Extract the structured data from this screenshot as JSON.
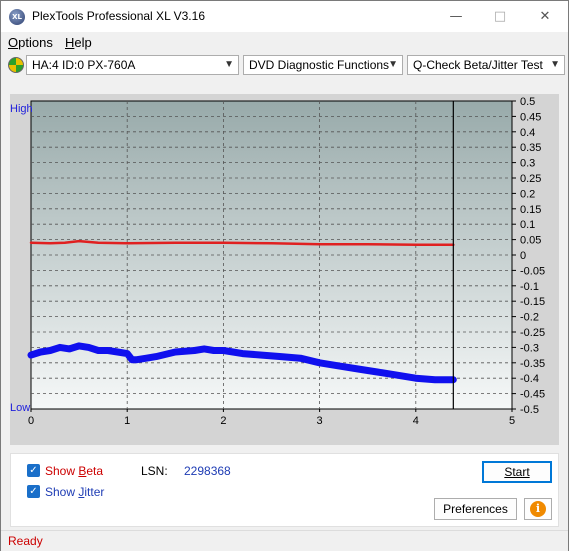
{
  "window": {
    "title": "PlexTools Professional XL V3.16",
    "minimize": "—",
    "maximize": "□",
    "close": "✕",
    "app_icon_text": "XL"
  },
  "menu": [
    {
      "label": "Options",
      "accel": "O",
      "rest": "ptions"
    },
    {
      "label": "Help",
      "accel": "H",
      "rest": "elp"
    }
  ],
  "toolbar": {
    "drive": "HA:4 ID:0  PX-760A",
    "function": "DVD Diagnostic Functions",
    "test": "Q-Check Beta/Jitter Test",
    "icons": [
      "disc-icon",
      "chevron-down-icon"
    ]
  },
  "chart_data": {
    "type": "line",
    "x_range": [
      0,
      5
    ],
    "x_ticks": [
      "0",
      "1",
      "2",
      "3",
      "4",
      "5"
    ],
    "y_right_range": [
      -0.5,
      0.5
    ],
    "y_right_ticks": [
      "0.5",
      "0.45",
      "0.4",
      "0.35",
      "0.3",
      "0.25",
      "0.2",
      "0.15",
      "0.1",
      "0.05",
      "0",
      "-0.05",
      "-0.1",
      "-0.15",
      "-0.2",
      "-0.25",
      "-0.3",
      "-0.35",
      "-0.4",
      "-0.45",
      "-0.5"
    ],
    "y_left_labels": {
      "top": "High",
      "bottom": "Low"
    },
    "end_marker_x": 4.39,
    "grid": true,
    "series": [
      {
        "color": "#e02020",
        "x": [
          0,
          0.2,
          0.35,
          0.5,
          0.7,
          1.0,
          1.5,
          2.0,
          2.5,
          3.0,
          3.5,
          4.0,
          4.39
        ],
        "y": [
          0.04,
          0.038,
          0.04,
          0.045,
          0.04,
          0.038,
          0.04,
          0.04,
          0.038,
          0.035,
          0.035,
          0.033,
          0.033
        ]
      },
      {
        "color": "#1010ee",
        "x": [
          0,
          0.1,
          0.2,
          0.3,
          0.4,
          0.5,
          0.6,
          0.7,
          0.8,
          0.9,
          1.0,
          1.05,
          1.1,
          1.2,
          1.3,
          1.5,
          1.7,
          1.8,
          1.9,
          2.0,
          2.1,
          2.2,
          2.4,
          2.6,
          2.8,
          3.0,
          3.2,
          3.4,
          3.6,
          3.8,
          4.0,
          4.2,
          4.39
        ],
        "y": [
          -0.325,
          -0.315,
          -0.31,
          -0.3,
          -0.305,
          -0.295,
          -0.3,
          -0.31,
          -0.31,
          -0.315,
          -0.32,
          -0.34,
          -0.34,
          -0.335,
          -0.33,
          -0.315,
          -0.31,
          -0.305,
          -0.31,
          -0.31,
          -0.315,
          -0.32,
          -0.325,
          -0.33,
          -0.335,
          -0.35,
          -0.36,
          -0.37,
          -0.38,
          -0.39,
          -0.4,
          -0.405,
          -0.405
        ]
      }
    ]
  },
  "bottom": {
    "show_beta": {
      "label": "Show Beta",
      "accel": "B",
      "checked": true,
      "color": "#cc0000"
    },
    "show_jitter": {
      "label": "Show Jitter",
      "accel": "J",
      "checked": true,
      "color": "#1e3cb4"
    },
    "lsn_label": "LSN:",
    "lsn_value": "2298368",
    "start_button": "Start",
    "preferences_button": "Preferences",
    "info_icon": "info-icon"
  },
  "status": {
    "text": "Ready"
  }
}
